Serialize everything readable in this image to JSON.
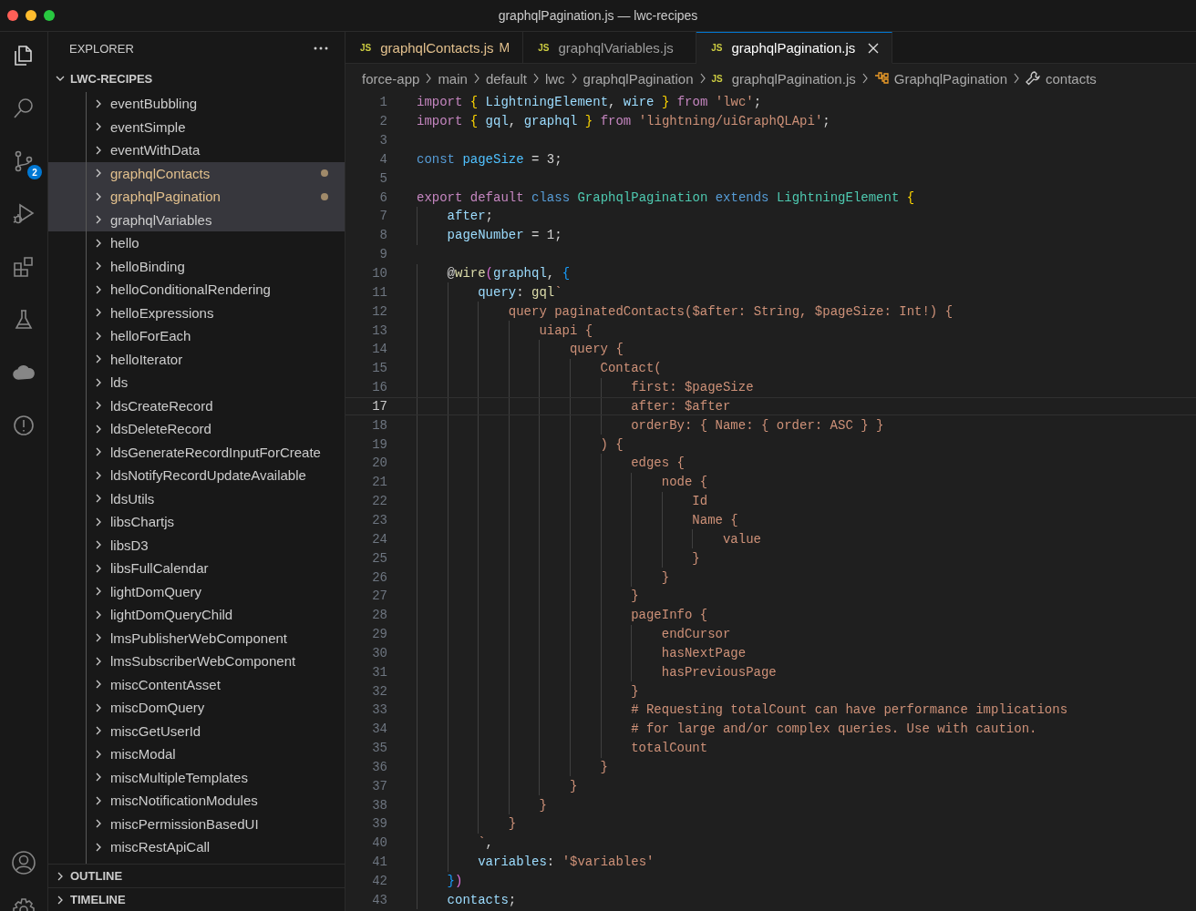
{
  "window": {
    "title": "graphqlPagination.js — lwc-recipes"
  },
  "activity_bar": {
    "items": [
      {
        "kind": "files",
        "selected": true
      },
      {
        "kind": "search",
        "selected": false
      },
      {
        "kind": "source-control",
        "selected": false,
        "badge": "2"
      },
      {
        "kind": "run-debug",
        "selected": false
      },
      {
        "kind": "extensions",
        "selected": false
      },
      {
        "kind": "testing",
        "selected": false
      },
      {
        "kind": "cloud",
        "selected": false
      },
      {
        "kind": "alert",
        "selected": false
      }
    ],
    "bottom": [
      {
        "kind": "account"
      },
      {
        "kind": "settings"
      }
    ]
  },
  "sidebar": {
    "title": "EXPLORER",
    "root": {
      "label": "LWC-RECIPES",
      "expanded": true
    },
    "items": [
      {
        "label": "eventBubbling",
        "selected": false,
        "modified": false
      },
      {
        "label": "eventSimple",
        "selected": false,
        "modified": false
      },
      {
        "label": "eventWithData",
        "selected": false,
        "modified": false
      },
      {
        "label": "graphqlContacts",
        "selected": true,
        "modified": true
      },
      {
        "label": "graphqlPagination",
        "selected": true,
        "modified": true
      },
      {
        "label": "graphqlVariables",
        "selected": true,
        "modified": false
      },
      {
        "label": "hello",
        "selected": false,
        "modified": false
      },
      {
        "label": "helloBinding",
        "selected": false,
        "modified": false
      },
      {
        "label": "helloConditionalRendering",
        "selected": false,
        "modified": false
      },
      {
        "label": "helloExpressions",
        "selected": false,
        "modified": false
      },
      {
        "label": "helloForEach",
        "selected": false,
        "modified": false
      },
      {
        "label": "helloIterator",
        "selected": false,
        "modified": false
      },
      {
        "label": "lds",
        "selected": false,
        "modified": false
      },
      {
        "label": "ldsCreateRecord",
        "selected": false,
        "modified": false
      },
      {
        "label": "ldsDeleteRecord",
        "selected": false,
        "modified": false
      },
      {
        "label": "ldsGenerateRecordInputForCreate",
        "selected": false,
        "modified": false
      },
      {
        "label": "ldsNotifyRecordUpdateAvailable",
        "selected": false,
        "modified": false
      },
      {
        "label": "ldsUtils",
        "selected": false,
        "modified": false
      },
      {
        "label": "libsChartjs",
        "selected": false,
        "modified": false
      },
      {
        "label": "libsD3",
        "selected": false,
        "modified": false
      },
      {
        "label": "libsFullCalendar",
        "selected": false,
        "modified": false
      },
      {
        "label": "lightDomQuery",
        "selected": false,
        "modified": false
      },
      {
        "label": "lightDomQueryChild",
        "selected": false,
        "modified": false
      },
      {
        "label": "lmsPublisherWebComponent",
        "selected": false,
        "modified": false
      },
      {
        "label": "lmsSubscriberWebComponent",
        "selected": false,
        "modified": false
      },
      {
        "label": "miscContentAsset",
        "selected": false,
        "modified": false
      },
      {
        "label": "miscDomQuery",
        "selected": false,
        "modified": false
      },
      {
        "label": "miscGetUserId",
        "selected": false,
        "modified": false
      },
      {
        "label": "miscModal",
        "selected": false,
        "modified": false
      },
      {
        "label": "miscMultipleTemplates",
        "selected": false,
        "modified": false
      },
      {
        "label": "miscNotificationModules",
        "selected": false,
        "modified": false
      },
      {
        "label": "miscPermissionBasedUI",
        "selected": false,
        "modified": false
      },
      {
        "label": "miscRestApiCall",
        "selected": false,
        "modified": false
      }
    ],
    "sections": [
      {
        "label": "OUTLINE",
        "expanded": false
      },
      {
        "label": "TIMELINE",
        "expanded": false
      }
    ]
  },
  "tabs": [
    {
      "icon": "JS",
      "label": "graphqlContacts.js",
      "badge": "M",
      "selected": false,
      "modified": true
    },
    {
      "icon": "JS",
      "label": "graphqlVariables.js",
      "selected": false,
      "modified": false
    },
    {
      "icon": "JS",
      "label": "graphqlPagination.js",
      "selected": true,
      "modified": false
    }
  ],
  "breadcrumb": [
    {
      "kind": "folder",
      "label": "force-app"
    },
    {
      "kind": "folder",
      "label": "main"
    },
    {
      "kind": "folder",
      "label": "default"
    },
    {
      "kind": "folder",
      "label": "lwc"
    },
    {
      "kind": "folder",
      "label": "graphqlPagination"
    },
    {
      "kind": "file",
      "icon": "JS",
      "label": "graphqlPagination.js"
    },
    {
      "kind": "class",
      "label": "GraphqlPagination"
    },
    {
      "kind": "method",
      "label": "contacts"
    }
  ],
  "editor": {
    "lines": [
      {
        "n": "1",
        "current": false,
        "tokens": [
          {
            "kind": "keyword",
            "text": "import "
          },
          {
            "kind": "brace1",
            "text": "{"
          },
          {
            "kind": "variable",
            "text": " LightningElement"
          },
          {
            "kind": "plain",
            "text": ","
          },
          {
            "kind": "variable",
            "text": " wire "
          },
          {
            "kind": "brace1",
            "text": "}"
          },
          {
            "kind": "keyword",
            "text": " from "
          },
          {
            "kind": "string",
            "text": "'lwc'"
          },
          {
            "kind": "plain",
            "text": ";"
          }
        ]
      },
      {
        "n": "2",
        "current": false,
        "tokens": [
          {
            "kind": "keyword",
            "text": "import "
          },
          {
            "kind": "brace1",
            "text": "{"
          },
          {
            "kind": "variable",
            "text": " gql"
          },
          {
            "kind": "plain",
            "text": ","
          },
          {
            "kind": "variable",
            "text": " graphql "
          },
          {
            "kind": "brace1",
            "text": "}"
          },
          {
            "kind": "keyword",
            "text": " from "
          },
          {
            "kind": "string",
            "text": "'lightning/uiGraphQLApi'"
          },
          {
            "kind": "plain",
            "text": ";"
          }
        ]
      },
      {
        "n": "3",
        "current": false
      },
      {
        "n": "4",
        "current": false,
        "tokens": [
          {
            "kind": "storage",
            "text": "const"
          },
          {
            "kind": "constant",
            "text": " pageSize"
          },
          {
            "kind": "plain",
            "text": " = 3;"
          }
        ]
      },
      {
        "n": "5",
        "current": false
      },
      {
        "n": "6",
        "current": false,
        "tokens": [
          {
            "kind": "keyword",
            "text": "export default "
          },
          {
            "kind": "storage",
            "text": "class "
          },
          {
            "kind": "type",
            "text": "GraphqlPagination "
          },
          {
            "kind": "storage",
            "text": "extends "
          },
          {
            "kind": "type",
            "text": "LightningElement "
          },
          {
            "kind": "brace1",
            "text": "{"
          }
        ]
      },
      {
        "n": "7",
        "current": false,
        "tokens": [
          {
            "kind": "variable",
            "text": "    after"
          },
          {
            "kind": "plain",
            "text": ";"
          }
        ]
      },
      {
        "n": "8",
        "current": false,
        "tokens": [
          {
            "kind": "variable",
            "text": "    pageNumber"
          },
          {
            "kind": "plain",
            "text": " = 1;"
          }
        ]
      },
      {
        "n": "9",
        "current": false
      },
      {
        "n": "10",
        "current": false,
        "tokens": [
          {
            "kind": "plain",
            "text": "    @"
          },
          {
            "kind": "function",
            "text": "wire"
          },
          {
            "kind": "brace2",
            "text": "("
          },
          {
            "kind": "variable",
            "text": "graphql"
          },
          {
            "kind": "plain",
            "text": ", "
          },
          {
            "kind": "brace3",
            "text": "{"
          }
        ]
      },
      {
        "n": "11",
        "current": false,
        "tokens": [
          {
            "kind": "variable",
            "text": "        query"
          },
          {
            "kind": "plain",
            "text": ": "
          },
          {
            "kind": "function",
            "text": "gql"
          },
          {
            "kind": "string",
            "text": "`"
          }
        ]
      },
      {
        "n": "12",
        "current": false,
        "tokens": [
          {
            "kind": "string",
            "text": "            query paginatedContacts($after: String, $pageSize: Int!) {"
          }
        ]
      },
      {
        "n": "13",
        "current": false,
        "tokens": [
          {
            "kind": "string",
            "text": "                uiapi {"
          }
        ]
      },
      {
        "n": "14",
        "current": false,
        "tokens": [
          {
            "kind": "string",
            "text": "                    query {"
          }
        ]
      },
      {
        "n": "15",
        "current": false,
        "tokens": [
          {
            "kind": "string",
            "text": "                        Contact("
          }
        ]
      },
      {
        "n": "16",
        "current": false,
        "tokens": [
          {
            "kind": "string",
            "text": "                            first: $pageSize"
          }
        ]
      },
      {
        "n": "17",
        "current": true,
        "tokens": [
          {
            "kind": "string",
            "text": "                            after: $after"
          }
        ]
      },
      {
        "n": "18",
        "current": false,
        "tokens": [
          {
            "kind": "string",
            "text": "                            orderBy: { Name: { order: ASC } }"
          }
        ]
      },
      {
        "n": "19",
        "current": false,
        "tokens": [
          {
            "kind": "string",
            "text": "                        ) {"
          }
        ]
      },
      {
        "n": "20",
        "current": false,
        "tokens": [
          {
            "kind": "string",
            "text": "                            edges {"
          }
        ]
      },
      {
        "n": "21",
        "current": false,
        "tokens": [
          {
            "kind": "string",
            "text": "                                node {"
          }
        ]
      },
      {
        "n": "22",
        "current": false,
        "tokens": [
          {
            "kind": "string",
            "text": "                                    Id"
          }
        ]
      },
      {
        "n": "23",
        "current": false,
        "tokens": [
          {
            "kind": "string",
            "text": "                                    Name {"
          }
        ]
      },
      {
        "n": "24",
        "current": false,
        "tokens": [
          {
            "kind": "string",
            "text": "                                        value"
          }
        ]
      },
      {
        "n": "25",
        "current": false,
        "tokens": [
          {
            "kind": "string",
            "text": "                                    }"
          }
        ]
      },
      {
        "n": "26",
        "current": false,
        "tokens": [
          {
            "kind": "string",
            "text": "                                }"
          }
        ]
      },
      {
        "n": "27",
        "current": false,
        "tokens": [
          {
            "kind": "string",
            "text": "                            }"
          }
        ]
      },
      {
        "n": "28",
        "current": false,
        "tokens": [
          {
            "kind": "string",
            "text": "                            pageInfo {"
          }
        ]
      },
      {
        "n": "29",
        "current": false,
        "tokens": [
          {
            "kind": "string",
            "text": "                                endCursor"
          }
        ]
      },
      {
        "n": "30",
        "current": false,
        "tokens": [
          {
            "kind": "string",
            "text": "                                hasNextPage"
          }
        ]
      },
      {
        "n": "31",
        "current": false,
        "tokens": [
          {
            "kind": "string",
            "text": "                                hasPreviousPage"
          }
        ]
      },
      {
        "n": "32",
        "current": false,
        "tokens": [
          {
            "kind": "string",
            "text": "                            }"
          }
        ]
      },
      {
        "n": "33",
        "current": false,
        "tokens": [
          {
            "kind": "string",
            "text": "                            # Requesting totalCount can have performance implications"
          }
        ]
      },
      {
        "n": "34",
        "current": false,
        "tokens": [
          {
            "kind": "string",
            "text": "                            # for large and/or complex queries. Use with caution."
          }
        ]
      },
      {
        "n": "35",
        "current": false,
        "tokens": [
          {
            "kind": "string",
            "text": "                            totalCount"
          }
        ]
      },
      {
        "n": "36",
        "current": false,
        "tokens": [
          {
            "kind": "string",
            "text": "                        }"
          }
        ]
      },
      {
        "n": "37",
        "current": false,
        "tokens": [
          {
            "kind": "string",
            "text": "                    }"
          }
        ]
      },
      {
        "n": "38",
        "current": false,
        "tokens": [
          {
            "kind": "string",
            "text": "                }"
          }
        ]
      },
      {
        "n": "39",
        "current": false,
        "tokens": [
          {
            "kind": "string",
            "text": "            }"
          }
        ]
      },
      {
        "n": "40",
        "current": false,
        "tokens": [
          {
            "kind": "string",
            "text": "        `"
          },
          {
            "kind": "plain",
            "text": ","
          }
        ]
      },
      {
        "n": "41",
        "current": false,
        "tokens": [
          {
            "kind": "variable",
            "text": "        variables"
          },
          {
            "kind": "plain",
            "text": ": "
          },
          {
            "kind": "string",
            "text": "'$variables'"
          }
        ]
      },
      {
        "n": "42",
        "current": false,
        "tokens": [
          {
            "kind": "brace3",
            "text": "    }"
          },
          {
            "kind": "brace2",
            "text": ")"
          }
        ]
      },
      {
        "n": "43",
        "current": false,
        "tokens": [
          {
            "kind": "variable",
            "text": "    contacts"
          },
          {
            "kind": "plain",
            "text": ";"
          }
        ]
      }
    ]
  }
}
